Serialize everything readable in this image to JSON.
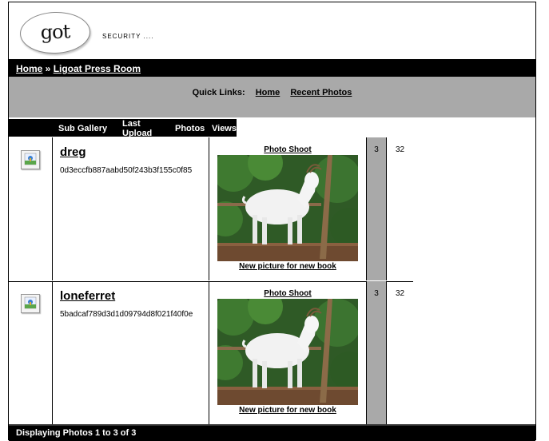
{
  "header": {
    "logo_text": "got goat?",
    "tagline": "SECURITY ...."
  },
  "breadcrumb": {
    "home": "Home",
    "separator": " » ",
    "current": "Ligoat Press Room"
  },
  "quick_links": {
    "label": "Quick Links:",
    "items": [
      "Home",
      "Recent Photos"
    ]
  },
  "table": {
    "columns": [
      "Sub Gallery",
      "Last Upload",
      "Photos",
      "Views"
    ],
    "rows": [
      {
        "name": "dreg",
        "hash": "0d3eccfb887aabd50f243b3f155c0f85",
        "photo_title": "Photo Shoot",
        "photo_caption": "New picture for new book",
        "photos": "3",
        "views": "32"
      },
      {
        "name": "loneferret",
        "hash": "5badcaf789d3d1d09794d8f021f40f0e",
        "photo_title": "Photo Shoot",
        "photo_caption": "New picture for new book",
        "photos": "3",
        "views": "32"
      }
    ]
  },
  "footer": {
    "text": "Displaying Photos 1 to 3 of 3"
  },
  "icons": [
    "gallery-image-icon",
    "goat-photo"
  ],
  "colors": {
    "bar": "#000000",
    "quick_bar": "#a9a9a9",
    "count_cell": "#a9a9a9"
  }
}
